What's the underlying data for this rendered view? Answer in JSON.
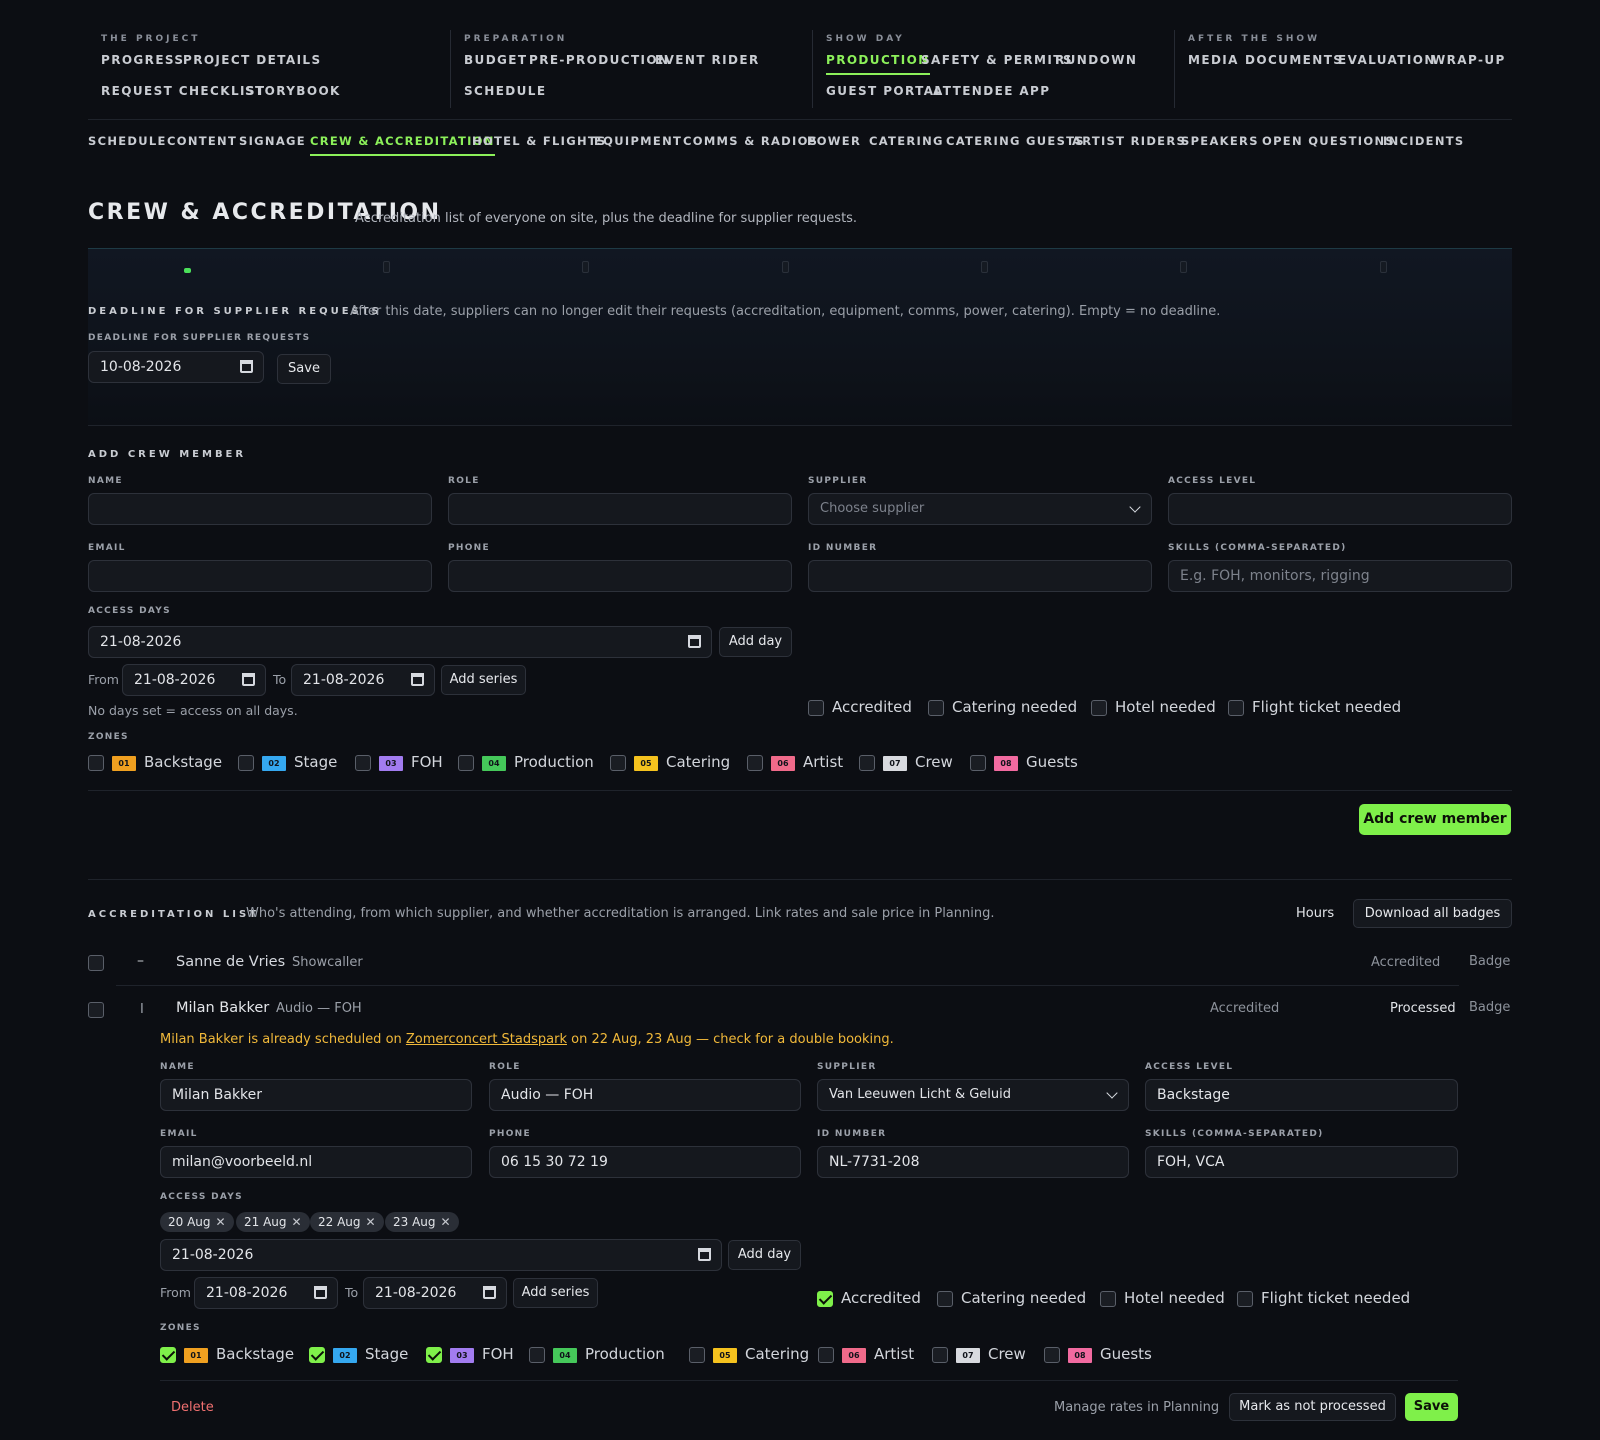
{
  "topnav": {
    "groups": [
      {
        "title": "THE PROJECT",
        "links": [
          "PROGRESS",
          "PROJECT DETAILS",
          "REQUEST CHECKLIST",
          "STORYBOOK"
        ]
      },
      {
        "title": "PREPARATION",
        "links": [
          "BUDGET",
          "PRE-PRODUCTION",
          "EVENT RIDER",
          "SCHEDULE"
        ]
      },
      {
        "title": "SHOW DAY",
        "links": [
          "PRODUCTION",
          "SAFETY & PERMITS",
          "RUNDOWN",
          "GUEST PORTAL",
          "ATTENDEE APP"
        ]
      },
      {
        "title": "AFTER THE SHOW",
        "links": [
          "MEDIA",
          "DOCUMENTS",
          "EVALUATION",
          "WRAP-UP"
        ]
      }
    ],
    "active": "PRODUCTION"
  },
  "subnav": {
    "items": [
      "SCHEDULE",
      "CONTENT",
      "SIGNAGE",
      "CREW & ACCREDITATION",
      "HOTEL & FLIGHTS",
      "EQUIPMENT",
      "COMMS & RADIOS",
      "POWER",
      "CATERING",
      "CATERING GUESTS",
      "ARTIST RIDERS",
      "SPEAKERS",
      "OPEN QUESTIONS",
      "INCIDENTS"
    ],
    "active": "CREW & ACCREDITATION"
  },
  "page": {
    "title": "CREW & ACCREDITATION",
    "subtitle": "Accreditation list of everyone on site, plus the deadline for supplier requests."
  },
  "deadline": {
    "section_label": "DEADLINE FOR SUPPLIER REQUESTS",
    "description": "After this date, suppliers can no longer edit their requests (accreditation, equipment, comms, power, catering). Empty = no deadline.",
    "field_label": "DEADLINE FOR SUPPLIER REQUESTS",
    "value": "10-08-2026",
    "save_label": "Save"
  },
  "add_crew": {
    "section_label": "ADD CREW MEMBER",
    "labels": {
      "name": "NAME",
      "role": "ROLE",
      "supplier": "SUPPLIER",
      "access_level": "ACCESS LEVEL",
      "email": "EMAIL",
      "phone": "PHONE",
      "id_number": "ID NUMBER",
      "skills": "SKILLS (COMMA-SEPARATED)",
      "access_days": "ACCESS DAYS",
      "zones": "ZONES"
    },
    "supplier_placeholder": "Choose supplier",
    "skills_placeholder": "E.g. FOH, monitors, rigging",
    "access_day_value": "21-08-2026",
    "add_day_label": "Add day",
    "from_label": "From",
    "to_label": "To",
    "from_value": "21-08-2026",
    "to_value": "21-08-2026",
    "add_series_label": "Add series",
    "no_days_note": "No days set = access on all days.",
    "flags": [
      "Accredited",
      "Catering needed",
      "Hotel needed",
      "Flight ticket needed"
    ],
    "submit_label": "Add crew member"
  },
  "zones": [
    {
      "code": "01",
      "name": "Backstage",
      "color": "#f0a020"
    },
    {
      "code": "02",
      "name": "Stage",
      "color": "#35a8f0"
    },
    {
      "code": "03",
      "name": "FOH",
      "color": "#a27cf0"
    },
    {
      "code": "04",
      "name": "Production",
      "color": "#45c85a"
    },
    {
      "code": "05",
      "name": "Catering",
      "color": "#f5c21e"
    },
    {
      "code": "06",
      "name": "Artist",
      "color": "#f06a8a"
    },
    {
      "code": "07",
      "name": "Crew",
      "color": "#d8dadf"
    },
    {
      "code": "08",
      "name": "Guests",
      "color": "#f26aa0"
    }
  ],
  "list": {
    "section_label": "ACCREDITATION LIST",
    "description": "Who's attending, from which supplier, and whether accreditation is arranged. Link rates and sale price in Planning.",
    "hours_label": "Hours",
    "download_label": "Download all badges",
    "rows": [
      {
        "name": "Sanne de Vries",
        "role": "Showcaller",
        "status": "Accredited",
        "badge": "Badge",
        "toggle": "–"
      },
      {
        "name": "Milan Bakker",
        "role": "Audio — FOH",
        "status": "Accredited",
        "processed": "Processed",
        "badge": "Badge",
        "toggle": "I"
      }
    ]
  },
  "edit": {
    "warning_pre": "Milan Bakker is already scheduled on ",
    "warning_link": "Zomerconcert Stadspark",
    "warning_post": " on 22 Aug, 23 Aug — check for a double booking.",
    "name": "Milan Bakker",
    "role": "Audio — FOH",
    "supplier": "Van Leeuwen Licht & Geluid",
    "access_level": "Backstage",
    "email": "milan@voorbeeld.nl",
    "phone": "06 15 30 72 19",
    "id_number": "NL-7731-208",
    "skills": "FOH, VCA",
    "days": [
      "20 Aug",
      "21 Aug",
      "22 Aug",
      "23 Aug"
    ],
    "access_day_value": "21-08-2026",
    "from_value": "21-08-2026",
    "to_value": "21-08-2026",
    "zones_checked": [
      "01",
      "02",
      "03"
    ],
    "flags_checked": [
      "Accredited"
    ],
    "delete_label": "Delete",
    "manage_rates_label": "Manage rates in Planning",
    "mark_label": "Mark as not processed",
    "save_label": "Save"
  }
}
